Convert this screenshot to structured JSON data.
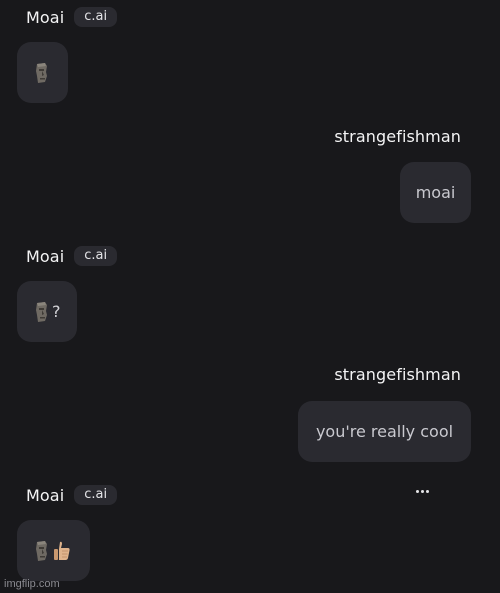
{
  "messages": [
    {
      "role": "bot",
      "author": "Moai",
      "badge": "c.ai",
      "content": "🗿"
    },
    {
      "role": "user",
      "author": "strangefishman",
      "content": "moai"
    },
    {
      "role": "bot",
      "author": "Moai",
      "badge": "c.ai",
      "content": "🗿?",
      "suffix": "?"
    },
    {
      "role": "user",
      "author": "strangefishman",
      "content": "you're really cool"
    },
    {
      "role": "bot",
      "author": "Moai",
      "badge": "c.ai",
      "content": "🗿👍🏼"
    }
  ],
  "typing_indicator": "...",
  "icons": {
    "moai": "moai-icon",
    "thumbs_up": "thumbs-up-icon",
    "more": "more-dots-icon"
  },
  "colors": {
    "background": "#18181b",
    "bubble": "#2a2a30",
    "badge": "#2a2a30",
    "text": "#e4e4e7"
  },
  "watermark": "imgflip.com"
}
